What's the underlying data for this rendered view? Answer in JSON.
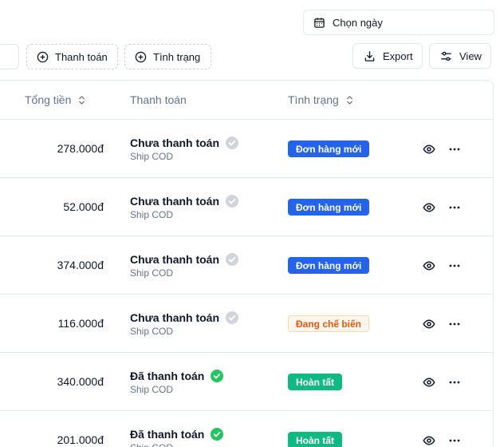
{
  "toolbar": {
    "date_label": "Chọn ngày",
    "filter_payment_label": "Thanh toán",
    "filter_status_label": "Tình trạng",
    "export_label": "Export",
    "view_label": "View"
  },
  "table": {
    "columns": {
      "total": "Tổng tiền",
      "payment": "Thanh toán",
      "status": "Tình trạng"
    },
    "rows": [
      {
        "amount": "278.000đ",
        "payment": "Chưa thanh toán",
        "paid": false,
        "method": "Ship COD",
        "status": "Đơn hàng mới",
        "status_kind": "new"
      },
      {
        "amount": "52.000đ",
        "payment": "Chưa thanh toán",
        "paid": false,
        "method": "Ship COD",
        "status": "Đơn hàng mới",
        "status_kind": "new"
      },
      {
        "amount": "374.000đ",
        "payment": "Chưa thanh toán",
        "paid": false,
        "method": "Ship COD",
        "status": "Đơn hàng mới",
        "status_kind": "new"
      },
      {
        "amount": "116.000đ",
        "payment": "Chưa thanh toán",
        "paid": false,
        "method": "Ship COD",
        "status": "Đang chế biến",
        "status_kind": "processing"
      },
      {
        "amount": "340.000đ",
        "payment": "Đã thanh toán",
        "paid": true,
        "method": "Ship COD",
        "status": "Hoàn tất",
        "status_kind": "done"
      },
      {
        "amount": "201.000đ",
        "payment": "Đã thanh toán",
        "paid": true,
        "method": "Ship COD",
        "status": "Hoàn tất",
        "status_kind": "done"
      }
    ]
  },
  "colors": {
    "badge_new_bg": "#2563eb",
    "badge_new_text": "#ffffff",
    "badge_processing_bg": "#fff7ed",
    "badge_processing_border": "#fed7aa",
    "badge_processing_text": "#ea580c",
    "badge_done_bg": "#10b981",
    "badge_done_text": "#ffffff",
    "paid_check": "#22c55e",
    "unpaid_check": "#d1d5db"
  },
  "icons": {
    "date": "calendar-icon",
    "filter": "plus-circle-icon",
    "export": "download-icon",
    "view": "sliders-icon",
    "sort": "sort-icon",
    "view_row": "eye-icon",
    "row_menu": "more-horizontal-icon",
    "payment_status": "check-circle-icon"
  }
}
